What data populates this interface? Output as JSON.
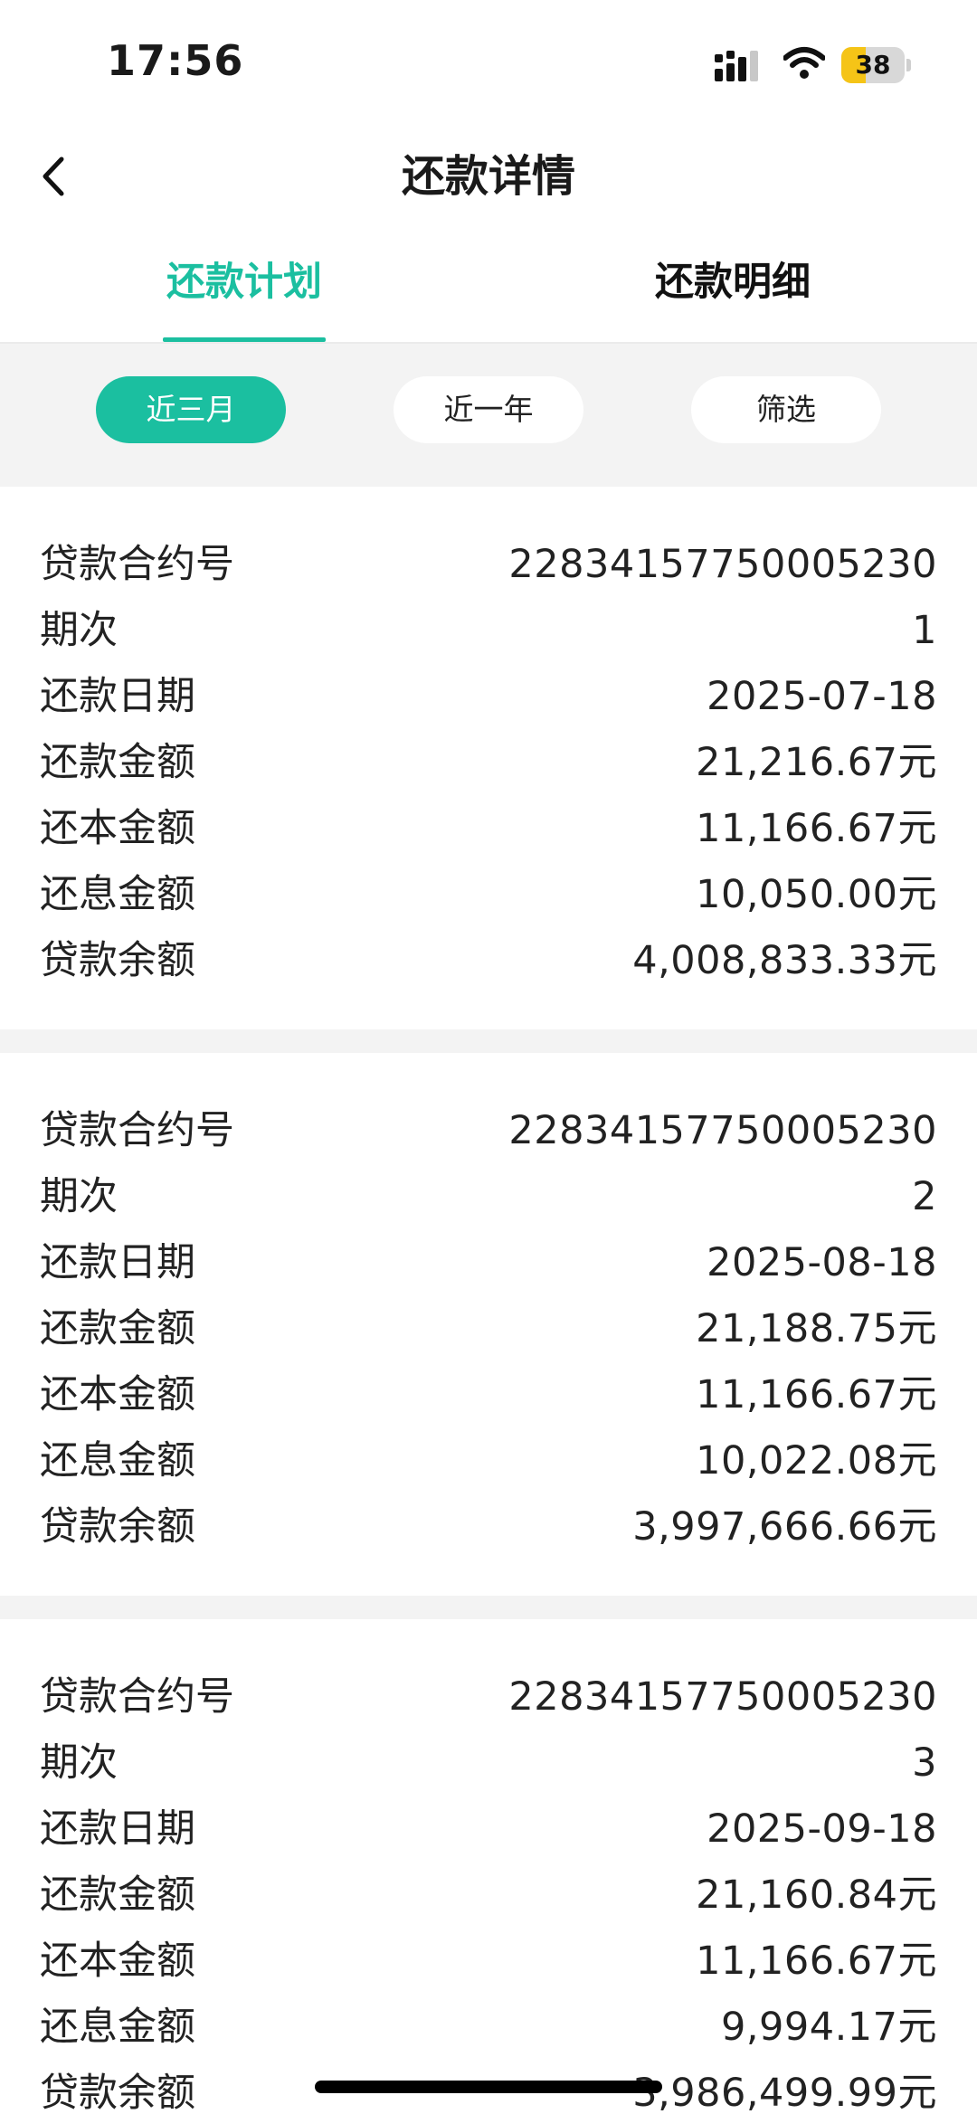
{
  "status_bar": {
    "time": "17:56",
    "battery_level": 38,
    "battery_text": "38"
  },
  "header": {
    "title": "还款详情"
  },
  "tabs": [
    {
      "label": "还款计划",
      "active": true
    },
    {
      "label": "还款明细",
      "active": false
    }
  ],
  "filters": [
    {
      "label": "近三月",
      "selected": true
    },
    {
      "label": "近一年",
      "selected": false
    },
    {
      "label": "筛选",
      "selected": false
    }
  ],
  "labels": {
    "contract": "贷款合约号",
    "period": "期次",
    "date": "还款日期",
    "amount": "还款金额",
    "principal": "还本金额",
    "interest": "还息金额",
    "balance": "贷款余额"
  },
  "records": [
    {
      "contract": "22834157750005230",
      "period": "1",
      "date": "2025-07-18",
      "amount": "21,216.67元",
      "principal": "11,166.67元",
      "interest": "10,050.00元",
      "balance": "4,008,833.33元"
    },
    {
      "contract": "22834157750005230",
      "period": "2",
      "date": "2025-08-18",
      "amount": "21,188.75元",
      "principal": "11,166.67元",
      "interest": "10,022.08元",
      "balance": "3,997,666.66元"
    },
    {
      "contract": "22834157750005230",
      "period": "3",
      "date": "2025-09-18",
      "amount": "21,160.84元",
      "principal": "11,166.67元",
      "interest": "9,994.17元",
      "balance": "3,986,499.99元"
    }
  ],
  "colors": {
    "accent": "#1bbfa0",
    "battery": "#f5c417",
    "background": "#f3f3f3"
  },
  "icons": {
    "back": "chevron-left-icon",
    "signal": "signal-icon",
    "wifi": "wifi-icon",
    "battery": "battery-icon"
  }
}
